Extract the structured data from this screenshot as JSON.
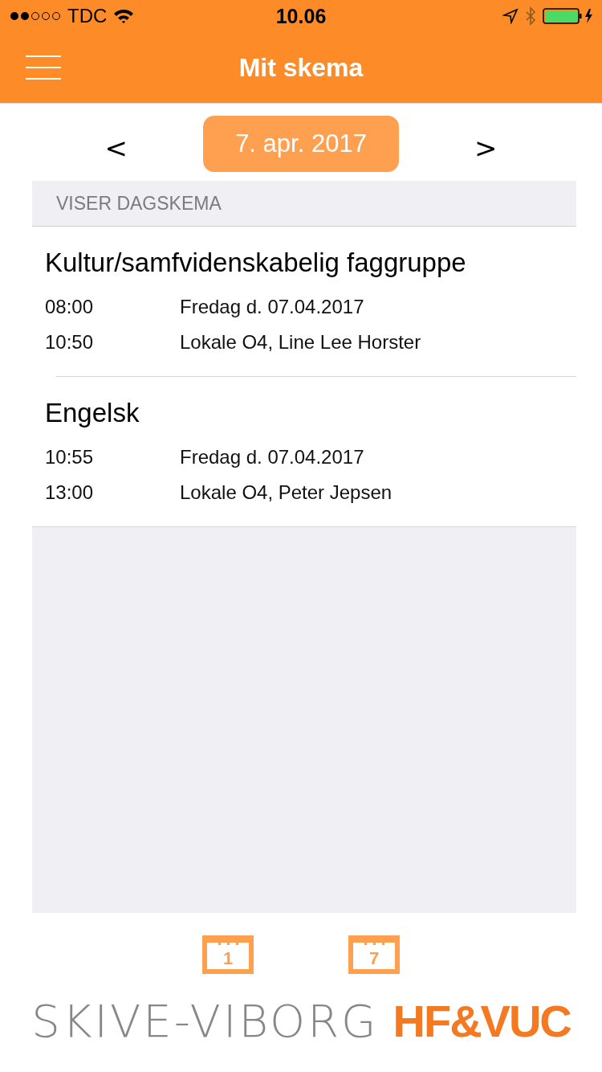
{
  "status_bar": {
    "carrier": "TDC",
    "time": "10.06"
  },
  "nav": {
    "title": "Mit skema"
  },
  "date_nav": {
    "prev": "<",
    "date": "7. apr. 2017",
    "next": ">"
  },
  "section_header": "VISER DAGSKEMA",
  "lessons": [
    {
      "title": "Kultur/samfvidenskabelig faggruppe",
      "start": "08:00",
      "end": "10:50",
      "day": "Fredag d. 07.04.2017",
      "place": "Lokale O4, Line Lee Horster"
    },
    {
      "title": "Engelsk",
      "start": "10:55",
      "end": "13:00",
      "day": "Fredag d. 07.04.2017",
      "place": "Lokale O4, Peter Jepsen"
    }
  ],
  "view_buttons": [
    {
      "number": "1"
    },
    {
      "number": "7"
    }
  ],
  "logo": {
    "left": "SKIVE-VIBORG",
    "right": "HF&VUC"
  }
}
